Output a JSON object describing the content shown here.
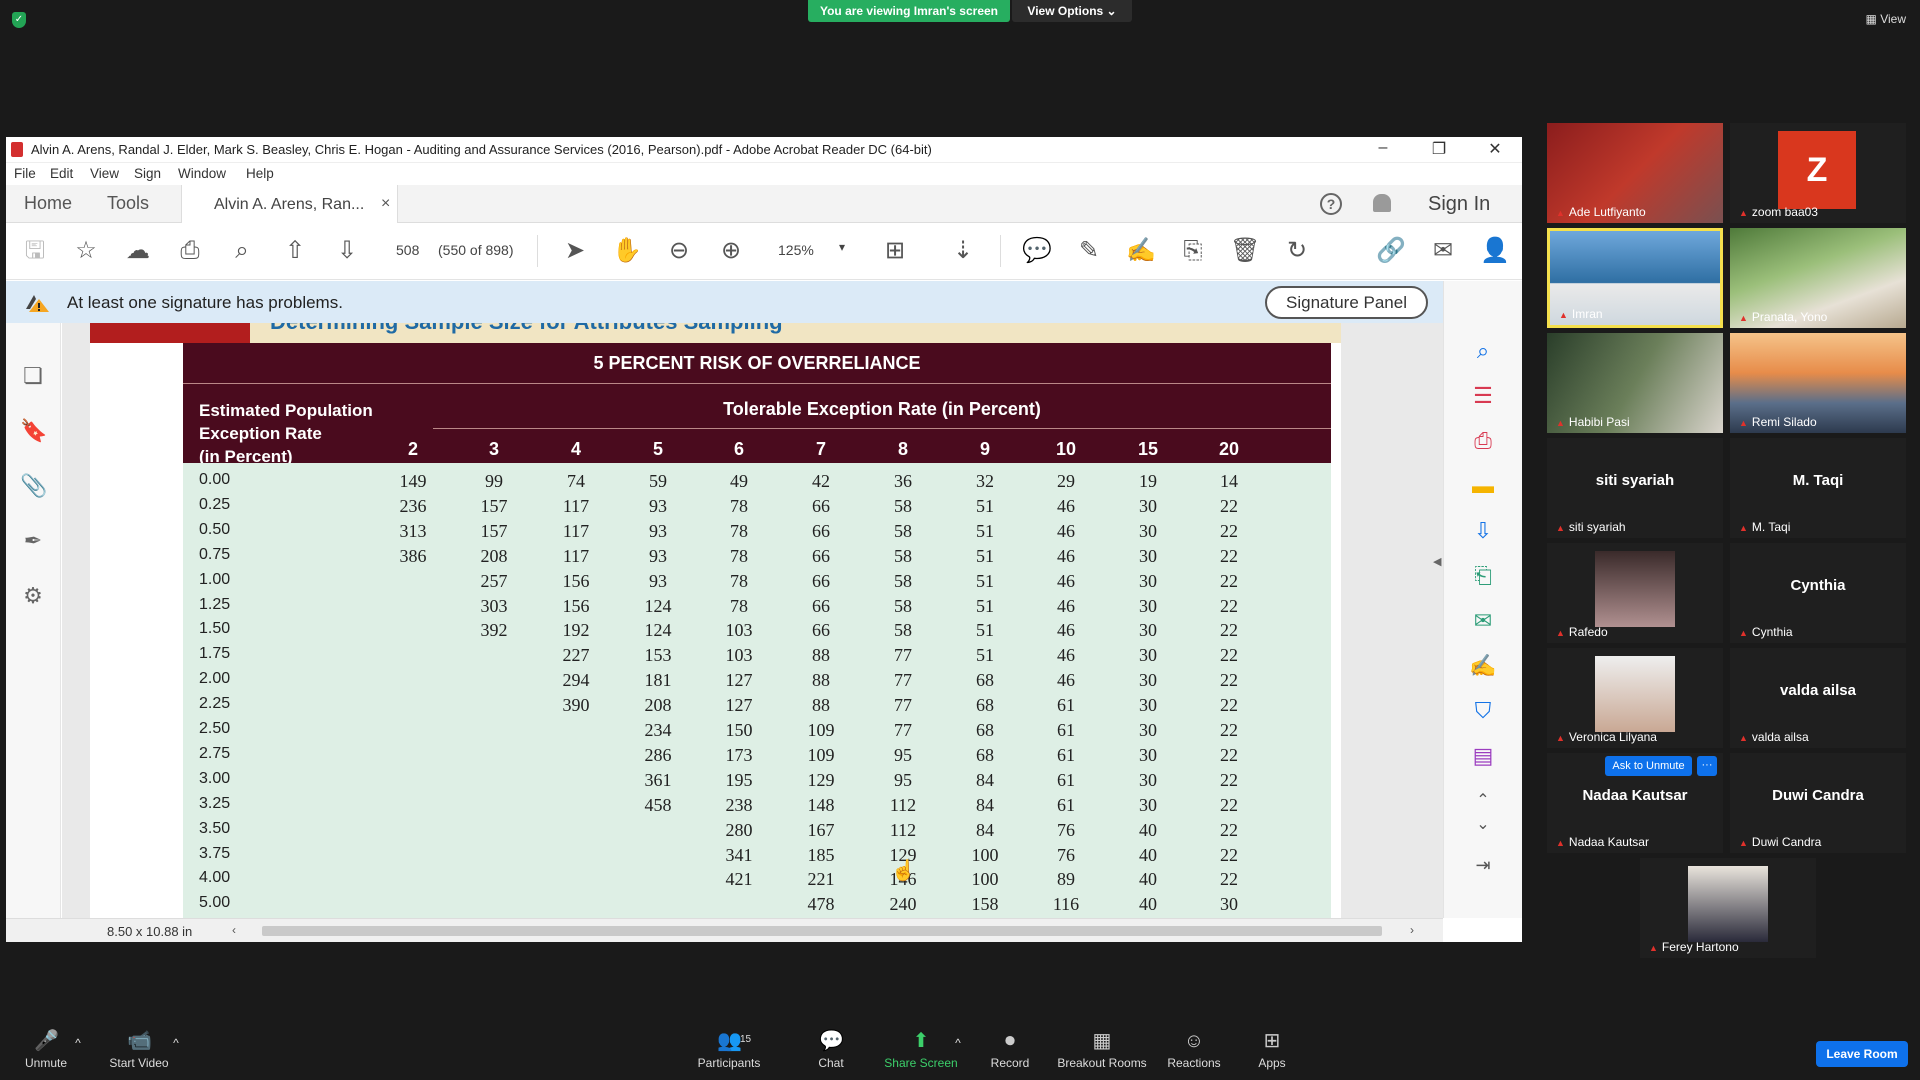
{
  "zoom": {
    "viewing_banner": "You are viewing Imran's screen",
    "view_options": "View Options",
    "view_label": "View",
    "bottom": {
      "unmute": "Unmute",
      "start_video": "Start Video",
      "participants": "Participants",
      "participants_count": "15",
      "chat": "Chat",
      "share_screen": "Share Screen",
      "record": "Record",
      "breakout_rooms": "Breakout Rooms",
      "reactions": "Reactions",
      "apps": "Apps",
      "leave_room": "Leave Room"
    },
    "ask_to_unmute": "Ask to Unmute",
    "more": "···",
    "participants": [
      {
        "name": "Ade Lutfiyanto",
        "big": ""
      },
      {
        "name": "zoom baa03",
        "big": "Z"
      },
      {
        "name": "Imran",
        "big": ""
      },
      {
        "name": "Pranata, Yono",
        "big": ""
      },
      {
        "name": "Habibi Pasi",
        "big": ""
      },
      {
        "name": "Remi Silado",
        "big": ""
      },
      {
        "name": "siti syariah",
        "big": "siti syariah"
      },
      {
        "name": "M. Taqi",
        "big": "M. Taqi"
      },
      {
        "name": "Rafedo",
        "big": ""
      },
      {
        "name": "Cynthia",
        "big": "Cynthia"
      },
      {
        "name": "Veronica Lilyana",
        "big": ""
      },
      {
        "name": "valda ailsa",
        "big": "valda ailsa"
      },
      {
        "name": "Nadaa Kautsar",
        "big": "Nadaa Kautsar"
      },
      {
        "name": "Duwi Candra",
        "big": "Duwi Candra"
      },
      {
        "name": "Ferey Hartono",
        "big": ""
      }
    ]
  },
  "acrobat": {
    "window_title": "Alvin A. Arens, Randal J. Elder, Mark S. Beasley, Chris E. Hogan - Auditing and Assurance Services (2016, Pearson).pdf - Adobe Acrobat Reader DC (64-bit)",
    "menu": [
      "File",
      "Edit",
      "View",
      "Sign",
      "Window",
      "Help"
    ],
    "tabs": {
      "home": "Home",
      "tools": "Tools",
      "doc": "Alvin A. Arens, Ran...",
      "close": "×"
    },
    "sign_in": "Sign In",
    "page_number": "508",
    "page_count": "(550 of 898)",
    "zoom_level": "125%",
    "signature_warning": "At least one signature has problems.",
    "signature_panel": "Signature Panel",
    "page_size": "8.50 x 10.88 in"
  },
  "table": {
    "cut_title": "Determining Sample Size for Attributes Sampling",
    "main_header": "5 PERCENT RISK OF OVERRELIANCE",
    "row_header": [
      "Estimated Population",
      "Exception Rate",
      "(in Percent)"
    ],
    "col_group_header": "Tolerable Exception Rate (in Percent)",
    "columns": [
      "2",
      "3",
      "4",
      "5",
      "6",
      "7",
      "8",
      "9",
      "10",
      "15",
      "20"
    ],
    "rows": [
      {
        "rate": "0.00",
        "v": [
          "149",
          "99",
          "74",
          "59",
          "49",
          "42",
          "36",
          "32",
          "29",
          "19",
          "14"
        ]
      },
      {
        "rate": "0.25",
        "v": [
          "236",
          "157",
          "117",
          "93",
          "78",
          "66",
          "58",
          "51",
          "46",
          "30",
          "22"
        ]
      },
      {
        "rate": "0.50",
        "v": [
          "313",
          "157",
          "117",
          "93",
          "78",
          "66",
          "58",
          "51",
          "46",
          "30",
          "22"
        ]
      },
      {
        "rate": "0.75",
        "v": [
          "386",
          "208",
          "117",
          "93",
          "78",
          "66",
          "58",
          "51",
          "46",
          "30",
          "22"
        ]
      },
      {
        "rate": "1.00",
        "v": [
          "",
          "257",
          "156",
          "93",
          "78",
          "66",
          "58",
          "51",
          "46",
          "30",
          "22"
        ]
      },
      {
        "rate": "1.25",
        "v": [
          "",
          "303",
          "156",
          "124",
          "78",
          "66",
          "58",
          "51",
          "46",
          "30",
          "22"
        ]
      },
      {
        "rate": "1.50",
        "v": [
          "",
          "392",
          "192",
          "124",
          "103",
          "66",
          "58",
          "51",
          "46",
          "30",
          "22"
        ]
      },
      {
        "rate": "1.75",
        "v": [
          "",
          "",
          "227",
          "153",
          "103",
          "88",
          "77",
          "51",
          "46",
          "30",
          "22"
        ]
      },
      {
        "rate": "2.00",
        "v": [
          "",
          "",
          "294",
          "181",
          "127",
          "88",
          "77",
          "68",
          "46",
          "30",
          "22"
        ]
      },
      {
        "rate": "2.25",
        "v": [
          "",
          "",
          "390",
          "208",
          "127",
          "88",
          "77",
          "68",
          "61",
          "30",
          "22"
        ]
      },
      {
        "rate": "2.50",
        "v": [
          "",
          "",
          "",
          "234",
          "150",
          "109",
          "77",
          "68",
          "61",
          "30",
          "22"
        ]
      },
      {
        "rate": "2.75",
        "v": [
          "",
          "",
          "",
          "286",
          "173",
          "109",
          "95",
          "68",
          "61",
          "30",
          "22"
        ]
      },
      {
        "rate": "3.00",
        "v": [
          "",
          "",
          "",
          "361",
          "195",
          "129",
          "95",
          "84",
          "61",
          "30",
          "22"
        ]
      },
      {
        "rate": "3.25",
        "v": [
          "",
          "",
          "",
          "458",
          "238",
          "148",
          "112",
          "84",
          "61",
          "30",
          "22"
        ]
      },
      {
        "rate": "3.50",
        "v": [
          "",
          "",
          "",
          "",
          "280",
          "167",
          "112",
          "84",
          "76",
          "40",
          "22"
        ]
      },
      {
        "rate": "3.75",
        "v": [
          "",
          "",
          "",
          "",
          "341",
          "185",
          "129",
          "100",
          "76",
          "40",
          "22"
        ]
      },
      {
        "rate": "4.00",
        "v": [
          "",
          "",
          "",
          "",
          "421",
          "221",
          "146",
          "100",
          "89",
          "40",
          "22"
        ]
      },
      {
        "rate": "5.00",
        "v": [
          "",
          "",
          "",
          "",
          "",
          "478",
          "240",
          "158",
          "116",
          "40",
          "30"
        ]
      }
    ]
  }
}
